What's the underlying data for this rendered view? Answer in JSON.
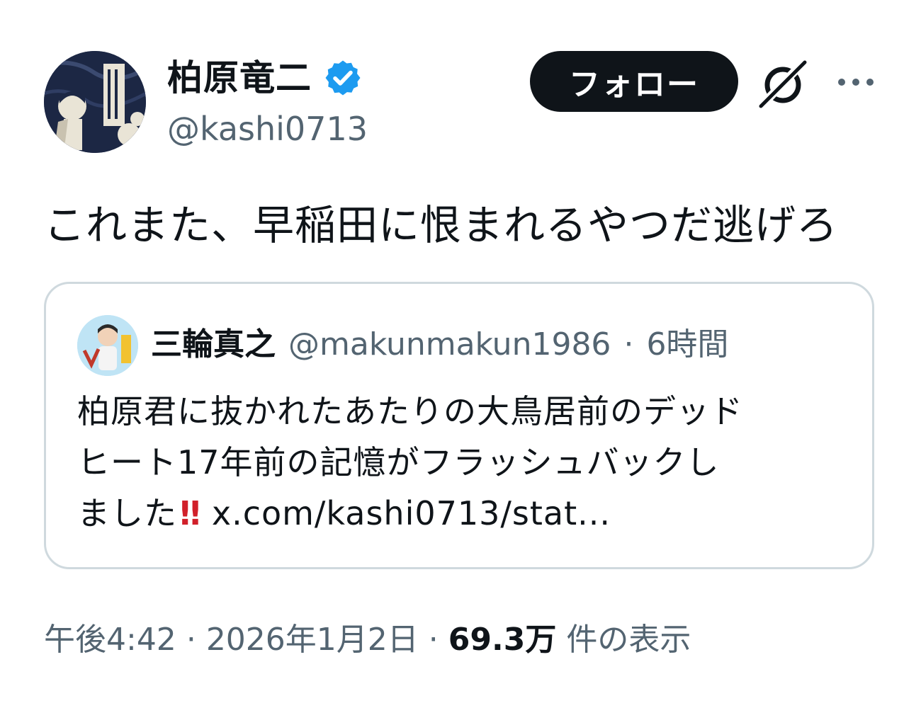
{
  "author": {
    "display_name": "柏原竜二",
    "handle": "@kashi0713",
    "verified": true
  },
  "actions": {
    "follow_label": "フォロー",
    "grok_icon": "grok-icon",
    "more_icon": "more-icon"
  },
  "tweet": {
    "text": "これまた、早稲田に恨まれるやつだ逃げろ"
  },
  "quote": {
    "display_name": "三輪真之",
    "handle": "@makunmakun1986",
    "separator": "·",
    "time": "6時間",
    "lines": [
      "柏原君に抜かれたあたりの大鳥居前のデッド",
      "ヒート17年前の記憶がフラッシュバックし",
      "ました"
    ],
    "emoji": "‼",
    "link": "x.com/kashi0713/stat..."
  },
  "meta": {
    "time": "午後4:42",
    "sep1": "·",
    "date": "2026年1月2日",
    "sep2": "·",
    "views_count": "69.3万",
    "views_label": "件の表示"
  },
  "colors": {
    "text": "#0f1419",
    "secondary": "#536471",
    "border": "#cfd9de",
    "verified_blue": "#1d9bf0",
    "button_bg": "#0f1419"
  }
}
